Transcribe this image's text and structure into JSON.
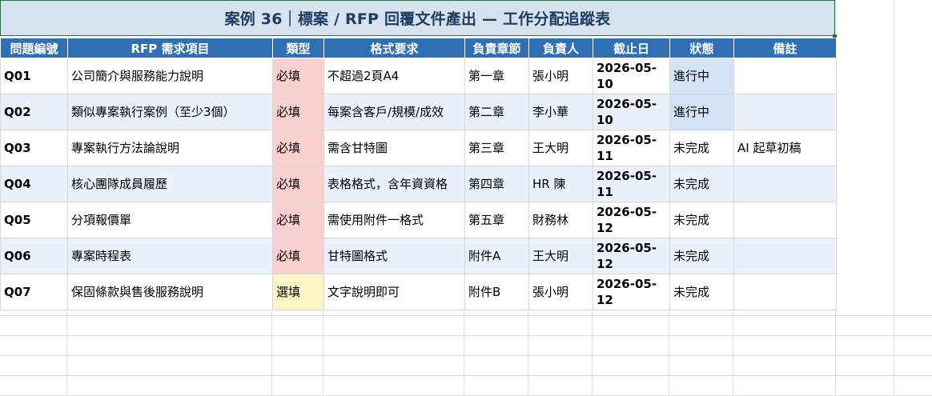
{
  "title": "案例 36｜標案 / RFP 回覆文件產出 — 工作分配追蹤表",
  "headers": [
    "問題編號",
    "RFP 需求項目",
    "類型",
    "格式要求",
    "負責章節",
    "負責人",
    "截止日",
    "狀態",
    "備註"
  ],
  "rows": [
    {
      "id": "Q01",
      "item": "公司簡介與服務能力說明",
      "type": "必填",
      "format": "不超過2頁A4",
      "chapter": "第一章",
      "owner": "張小明",
      "due": "2026-05-10",
      "status": "進行中",
      "note": ""
    },
    {
      "id": "Q02",
      "item": "類似專案執行案例（至少3個）",
      "type": "必填",
      "format": "每案含客戶/規模/成效",
      "chapter": "第二章",
      "owner": "李小華",
      "due": "2026-05-10",
      "status": "進行中",
      "note": ""
    },
    {
      "id": "Q03",
      "item": "專案執行方法論說明",
      "type": "必填",
      "format": "需含甘特圖",
      "chapter": "第三章",
      "owner": "王大明",
      "due": "2026-05-11",
      "status": "未完成",
      "note": "AI 起草初稿"
    },
    {
      "id": "Q04",
      "item": "核心團隊成員履歷",
      "type": "必填",
      "format": "表格格式，含年資資格",
      "chapter": "第四章",
      "owner": "HR 陳",
      "due": "2026-05-11",
      "status": "未完成",
      "note": ""
    },
    {
      "id": "Q05",
      "item": "分項報價單",
      "type": "必填",
      "format": "需使用附件一格式",
      "chapter": "第五章",
      "owner": "財務林",
      "due": "2026-05-12",
      "status": "未完成",
      "note": ""
    },
    {
      "id": "Q06",
      "item": "專案時程表",
      "type": "必填",
      "format": "甘特圖格式",
      "chapter": "附件A",
      "owner": "王大明",
      "due": "2026-05-12",
      "status": "未完成",
      "note": ""
    },
    {
      "id": "Q07",
      "item": "保固條款與售後服務說明",
      "type": "選填",
      "format": "文字說明即可",
      "chapter": "附件B",
      "owner": "張小明",
      "due": "2026-05-12",
      "status": "未完成",
      "note": ""
    }
  ],
  "colors": {
    "header_bg": "#2e6fb5",
    "title_bg": "#d6e2ee",
    "required": "#f9cfd0",
    "optional": "#fdf5c6",
    "in_progress": "#d3e3f7",
    "stripe": "#eaf1fa"
  }
}
